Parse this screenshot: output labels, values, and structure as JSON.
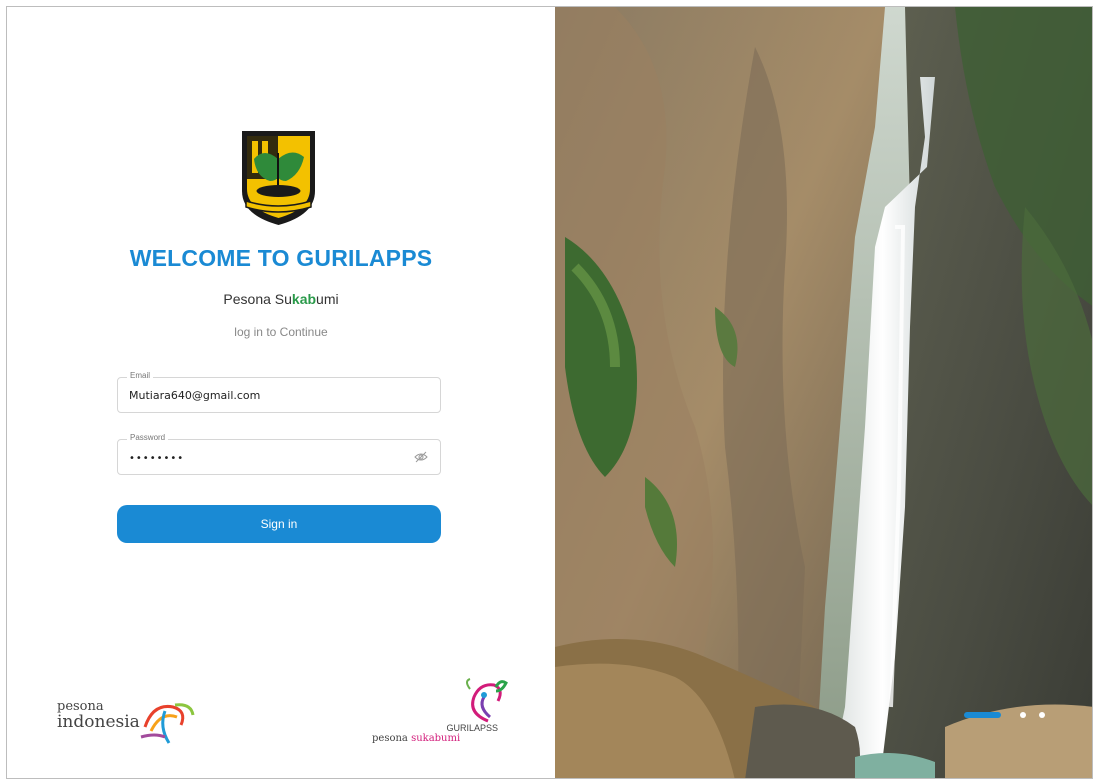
{
  "welcome_title": "WELCOME TO GURILAPPS",
  "subtitle": {
    "part1": "Pesona Su",
    "part2": "kab",
    "part3": "umi"
  },
  "hint": "log in to Continue",
  "form": {
    "email_label": "Email",
    "email_value": "Mutiara640@gmail.com",
    "password_label": "Password",
    "password_value": "••••••••",
    "sign_in_label": "Sign in"
  },
  "logos": {
    "pesona_indonesia_line1": "pesona",
    "pesona_indonesia_line2": "indonesia",
    "gurilapss_text": "GURILAPSS",
    "pesona_sukabumi_part1": "pesona ",
    "pesona_sukabumi_part2": "sukabumi"
  },
  "colors": {
    "accent": "#1a8ad4",
    "crest_yellow": "#f3c100",
    "crest_black": "#1a1a1a"
  },
  "carousel": {
    "slide_count": 3,
    "active_index": 0
  }
}
